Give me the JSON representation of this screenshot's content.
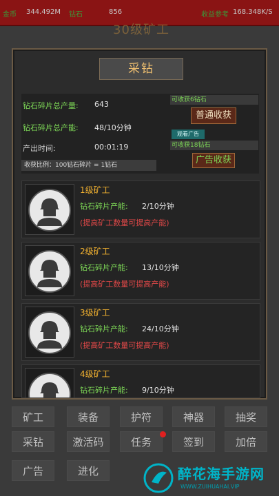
{
  "topbar": {
    "gold_label": "金币",
    "gold_value": "344.492M",
    "diamond_label": "钻石",
    "diamond_value": "856",
    "income_label": "收益参考",
    "income_value": "168.348K/S"
  },
  "background_title": "30级矿工",
  "panel": {
    "title": "采钻",
    "summary": {
      "total_output_label": "钻石碎片总产量:",
      "total_output_value": "643",
      "total_capacity_label": "钻石碎片总产能:",
      "total_capacity_value": "48/10分钟",
      "time_label": "产出时间:",
      "time_value": "00:01:19",
      "ratio_text": "收获比例：100钻石碎片 = 1钻石"
    },
    "normal_claim": {
      "info": "可收获6钻石",
      "button": "普通收获"
    },
    "ad_claim": {
      "tag": "观看广告",
      "info": "可收获18钻石",
      "button": "广告收获"
    },
    "miners": [
      {
        "level": "1级矿工",
        "capacity_label": "钻石碎片产能:",
        "capacity_value": "2/10分钟",
        "hint": "(提高矿工数量可提高产能)"
      },
      {
        "level": "2级矿工",
        "capacity_label": "钻石碎片产能:",
        "capacity_value": "13/10分钟",
        "hint": "(提高矿工数量可提高产能)"
      },
      {
        "level": "3级矿工",
        "capacity_label": "钻石碎片产能:",
        "capacity_value": "24/10分钟",
        "hint": "(提高矿工数量可提高产能)"
      },
      {
        "level": "4级矿工",
        "capacity_label": "钻石碎片产能:",
        "capacity_value": "9/10分钟",
        "hint": ""
      }
    ]
  },
  "nav": {
    "row1": [
      "矿工",
      "装备",
      "护符",
      "神器",
      "抽奖"
    ],
    "row2": [
      "采钻",
      "激活码",
      "任务",
      "签到",
      "加倍"
    ],
    "row3": [
      "广告",
      "进化"
    ]
  },
  "watermark": {
    "text": "醉花海手游网",
    "url": "WWW.ZUIHUAHAI.VIP"
  },
  "colors": {
    "topbar": "#8a1414",
    "green_label": "#7ed957",
    "level_text": "#f0b030",
    "hint_red": "#e04848",
    "title_gold": "#f0c070",
    "watermark": "#00b4c8"
  }
}
